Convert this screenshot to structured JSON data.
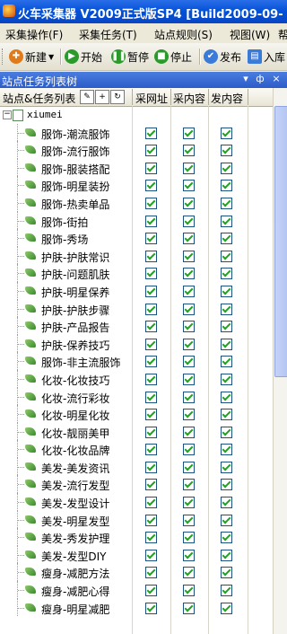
{
  "window": {
    "title": "火车采集器 V2009正式版SP4 [Build2009-09-"
  },
  "menu": [
    "采集操作(F)",
    "采集任务(T)",
    "站点规则(S)",
    "视图(W)",
    "帮"
  ],
  "toolbar": {
    "new_label": "新建",
    "start_label": "开始",
    "pause_label": "暂停",
    "stop_label": "停止",
    "publish_label": "发布",
    "import_label": "入库"
  },
  "panel": {
    "title": "站点任务列表树",
    "pin": "ф",
    "close": "×"
  },
  "columns": {
    "name": "站点&任务列表",
    "url": "采网址",
    "content": "采内容",
    "publish": "发内容"
  },
  "root": {
    "label": "xiumei"
  },
  "tasks": [
    "服饰-潮流服饰",
    "服饰-流行服饰",
    "服饰-服装搭配",
    "服饰-明星装扮",
    "服饰-热卖单品",
    "服饰-街拍",
    "服饰-秀场",
    "护肤-护肤常识",
    "护肤-问题肌肤",
    "护肤-明星保养",
    "护肤-护肤步骤",
    "护肤-产品报告",
    "护肤-保养技巧",
    "服饰-非主流服饰",
    "化妆-化妆技巧",
    "化妆-流行彩妆",
    "化妆-明星化妆",
    "化妆-靓丽美甲",
    "化妆-化妆品牌",
    "美发-美发资讯",
    "美发-流行发型",
    "美发-发型设计",
    "美发-明星发型",
    "美发-秀发护理",
    "美发-发型DIY",
    "瘦身-减肥方法",
    "瘦身-减肥心得",
    "瘦身-明星减肥"
  ]
}
